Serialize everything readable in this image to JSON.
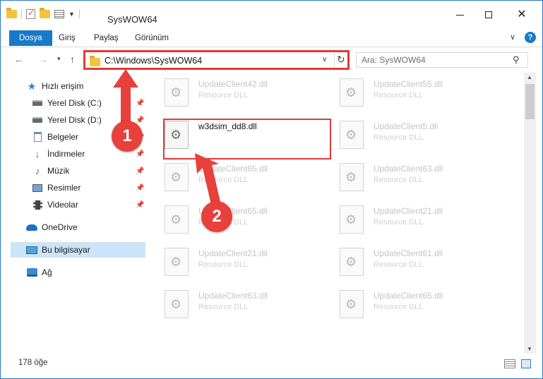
{
  "window": {
    "title": "SysWOW64",
    "controls": {
      "minimize": "minimize",
      "maximize": "maximize",
      "close": "✕"
    }
  },
  "ribbon": {
    "tabs": [
      "Dosya",
      "Giriş",
      "Paylaş",
      "Görünüm"
    ],
    "active_tab": "Dosya",
    "accent": "#1979ca",
    "help": "?"
  },
  "address_bar": {
    "path": "C:\\Windows\\SysWOW64",
    "highlight_color": "#e23a3a"
  },
  "search": {
    "placeholder": "Ara: SysWOW64"
  },
  "navigation_pane": {
    "items": [
      {
        "label": "Hızlı erişim",
        "icon": "star-icon",
        "pinned": false
      },
      {
        "label": "Yerel Disk (C:)",
        "icon": "disk-icon",
        "pinned": true
      },
      {
        "label": "Yerel Disk (D:)",
        "icon": "disk-icon",
        "pinned": true
      },
      {
        "label": "Belgeler",
        "icon": "documents-icon",
        "pinned": true
      },
      {
        "label": "İndirmeler",
        "icon": "download-icon",
        "pinned": true
      },
      {
        "label": "Müzik",
        "icon": "music-icon",
        "pinned": true
      },
      {
        "label": "Resimler",
        "icon": "pictures-icon",
        "pinned": true
      },
      {
        "label": "Videolar",
        "icon": "videos-icon",
        "pinned": true
      },
      {
        "label": "OneDrive",
        "icon": "onedrive-icon",
        "pinned": false
      },
      {
        "label": "Bu bilgisayar",
        "icon": "this-pc-icon",
        "pinned": false,
        "selected": true
      },
      {
        "label": "Ağ",
        "icon": "network-icon",
        "pinned": false
      }
    ]
  },
  "files": [
    {
      "name": "UpdateClient42.dll",
      "type": "Resource DLL"
    },
    {
      "name": "UpdateClient55.dll",
      "type": "Resource DLL"
    },
    {
      "name": "w3dsim_dd8.dll",
      "type": "",
      "highlighted": true
    },
    {
      "name": "UpdateClient5.dll",
      "type": "Resource DLL"
    },
    {
      "name": "UpdateClient65.dll",
      "type": "Resource DLL"
    },
    {
      "name": "UpdateClient63.dll",
      "type": "Resource DLL"
    },
    {
      "name": "UpdateClient65.dll",
      "type": "Resource DLL"
    },
    {
      "name": "UpdateClient21.dll",
      "type": "Resource DLL"
    },
    {
      "name": "UpdateClient21.dll",
      "type": "Resource DLL"
    },
    {
      "name": "UpdateClient61.dll",
      "type": "Resource DLL"
    },
    {
      "name": "UpdateClient63.dll",
      "type": "Resource DLL"
    },
    {
      "name": "UpdateClient65.dll",
      "type": "Resource DLL"
    }
  ],
  "status_bar": {
    "item_count": "178 öğe"
  },
  "annotations": {
    "step1": "1",
    "step2": "2",
    "color": "#e8403a"
  }
}
